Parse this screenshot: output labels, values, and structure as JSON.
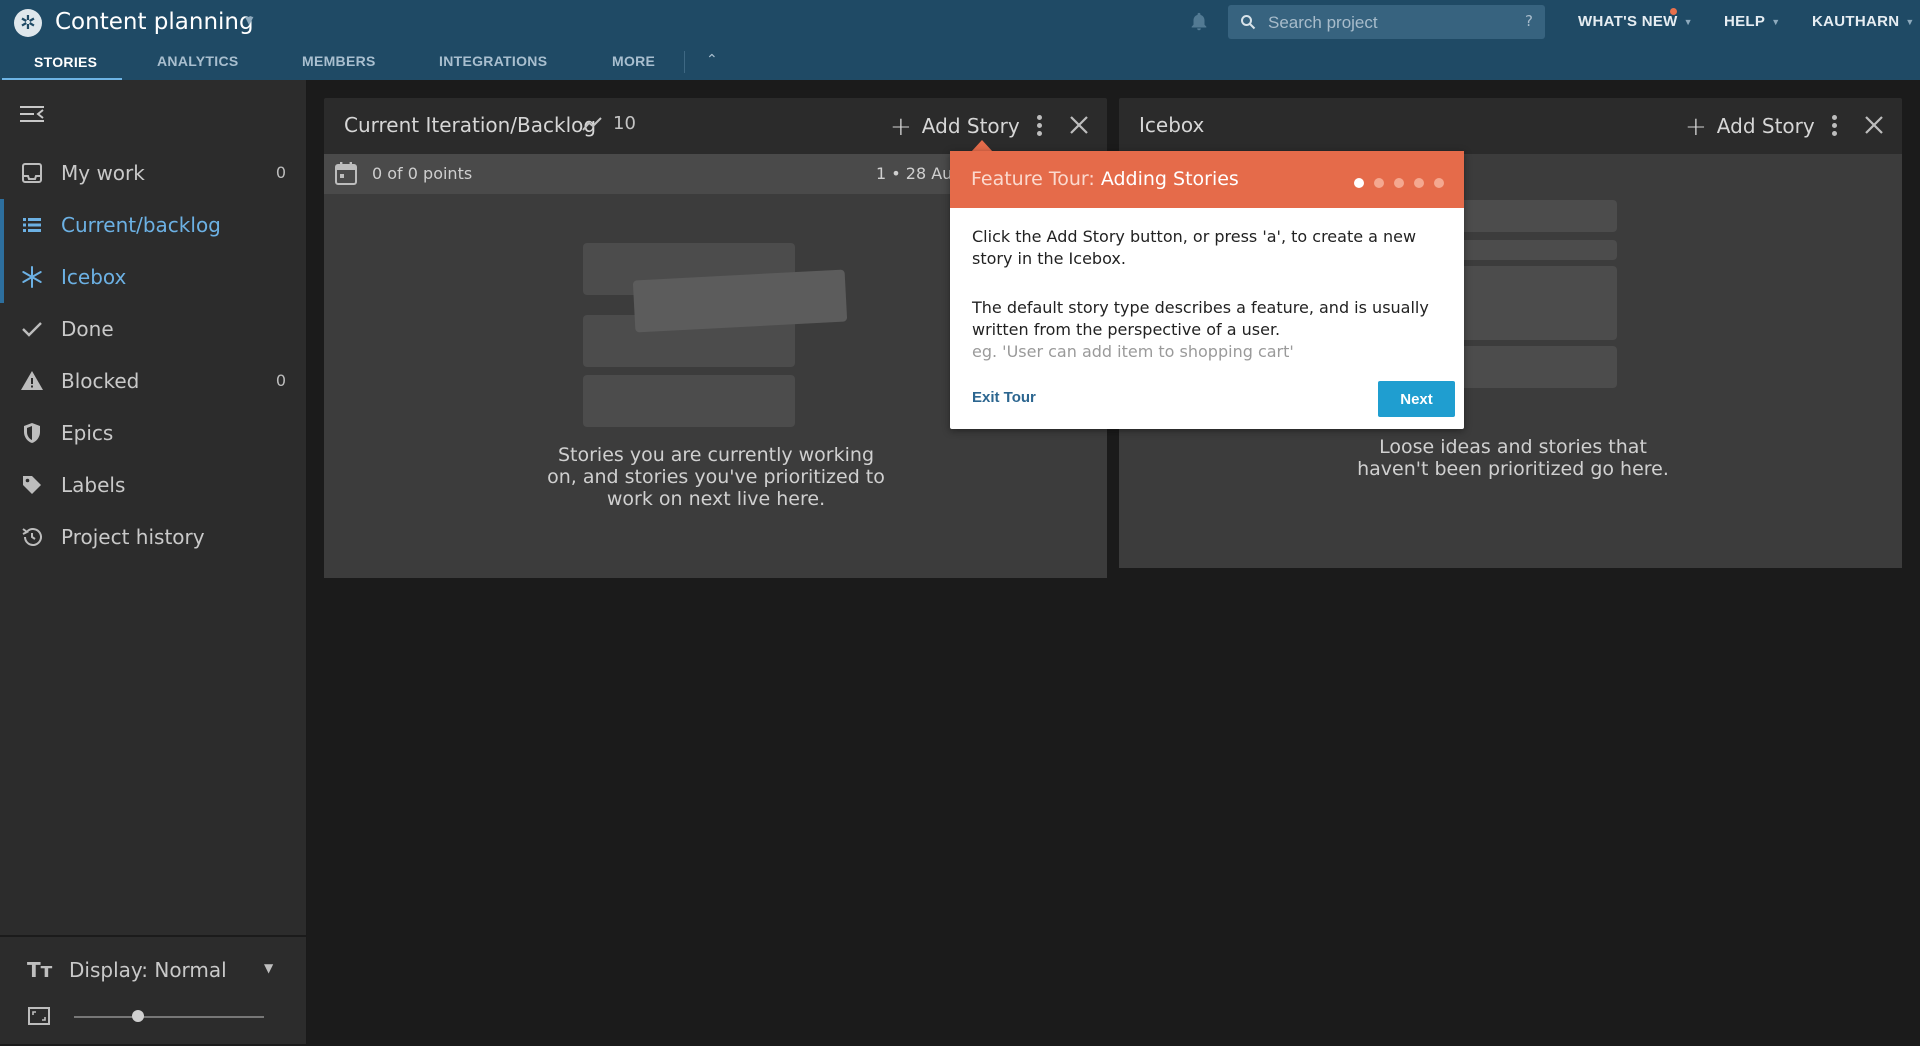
{
  "header": {
    "project_title": "Content planning",
    "search_placeholder": "Search project",
    "search_help": "?",
    "whats_new": "WHAT'S NEW",
    "help": "HELP",
    "user": "KAUTHARN",
    "accent_notification": "#e8704c"
  },
  "tabs": [
    {
      "label": "STORIES",
      "active": true
    },
    {
      "label": "ANALYTICS",
      "active": false
    },
    {
      "label": "MEMBERS",
      "active": false
    },
    {
      "label": "INTEGRATIONS",
      "active": false
    },
    {
      "label": "MORE",
      "active": false
    }
  ],
  "sidebar": {
    "items": [
      {
        "label": "My work",
        "count": "0",
        "icon": "inbox-icon"
      },
      {
        "label": "Current/backlog",
        "count": "",
        "icon": "list-icon",
        "active": true
      },
      {
        "label": "Icebox",
        "count": "",
        "icon": "snowflake-icon",
        "active": true
      },
      {
        "label": "Done",
        "count": "",
        "icon": "check-icon"
      },
      {
        "label": "Blocked",
        "count": "0",
        "icon": "warning-icon"
      },
      {
        "label": "Epics",
        "count": "",
        "icon": "shield-icon"
      },
      {
        "label": "Labels",
        "count": "",
        "icon": "tag-icon"
      },
      {
        "label": "Project history",
        "count": "",
        "icon": "history-icon"
      }
    ],
    "display_label": "Display: Normal",
    "zoom_level": 0.35
  },
  "panels": {
    "backlog": {
      "title": "Current Iteration/Backlog",
      "velocity": "10",
      "add_story": "Add Story",
      "points": "0 of 0 points",
      "iteration": "1 • 28 Aug",
      "empty_message": "Stories you are currently working on, and stories you've prioritized to work on next live here."
    },
    "icebox": {
      "title": "Icebox",
      "add_story": "Add Story",
      "empty_message": "Loose ideas and stories that haven't been prioritized go here."
    }
  },
  "tour": {
    "title_prefix": "Feature Tour:",
    "title": "Adding Stories",
    "step": 1,
    "total_steps": 5,
    "paragraph1": "Click the Add Story button, or press 'a', to create a new story in the Icebox.",
    "paragraph2": "The default story type describes a feature, and is usually written from the perspective of a user.",
    "example": "eg. 'User can add item to shopping cart'",
    "exit": "Exit Tour",
    "next": "Next",
    "accent": "#e56b4a"
  }
}
